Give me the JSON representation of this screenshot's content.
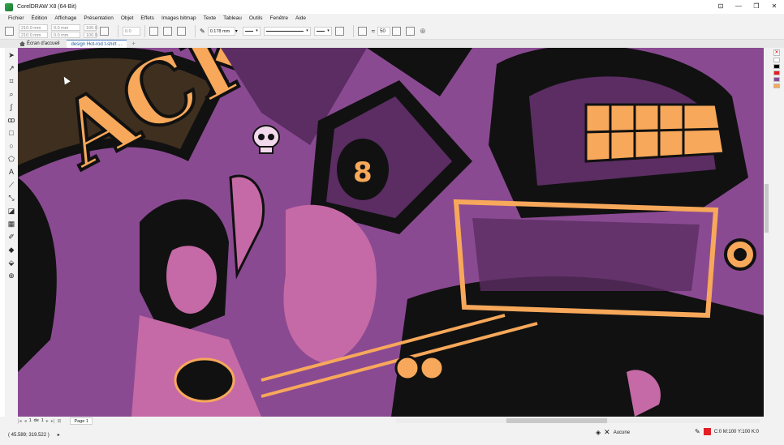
{
  "window": {
    "title": "CorelDRAW X8 (64-Bit)",
    "controls": [
      "⊡",
      "—",
      "❐",
      "✕"
    ]
  },
  "menu": [
    "Fichier",
    "Édition",
    "Affichage",
    "Présentation",
    "Objet",
    "Effets",
    "Images bitmap",
    "Texte",
    "Tableau",
    "Outils",
    "Fenêtre",
    "Aide"
  ],
  "propbar": {
    "width": "210.0 mm",
    "height": "210.0 mm",
    "x": "0.0 mm",
    "y": "0.0 mm",
    "scale_x": "100.0",
    "scale_y": "100.0",
    "rotation": "0.0",
    "outline_width": "0.178 mm",
    "smoothing": "50"
  },
  "tabs": {
    "home": "Écran d'accueil",
    "document": "design Hot-rod t-shirt ...",
    "add": "+"
  },
  "pagebar": {
    "current": "1",
    "of_label": "de",
    "total": "1",
    "page_name": "Page 1"
  },
  "status": {
    "coordinates": "( 45.589; 319.522 )",
    "fill_label": "Aucune",
    "outline_label": "C:0 M:100 Y:100 K:0"
  },
  "palette_colors": [
    "#ffffff",
    "#000000",
    "#e31e24",
    "#8a4a92",
    "#f7a85a"
  ],
  "artwork_colors": {
    "purple": "#8a4a92",
    "dark_purple": "#5b2d63",
    "orange": "#f7a85a",
    "black": "#111111",
    "pink": "#c56aa6"
  },
  "artwork_text": "ACKTO"
}
